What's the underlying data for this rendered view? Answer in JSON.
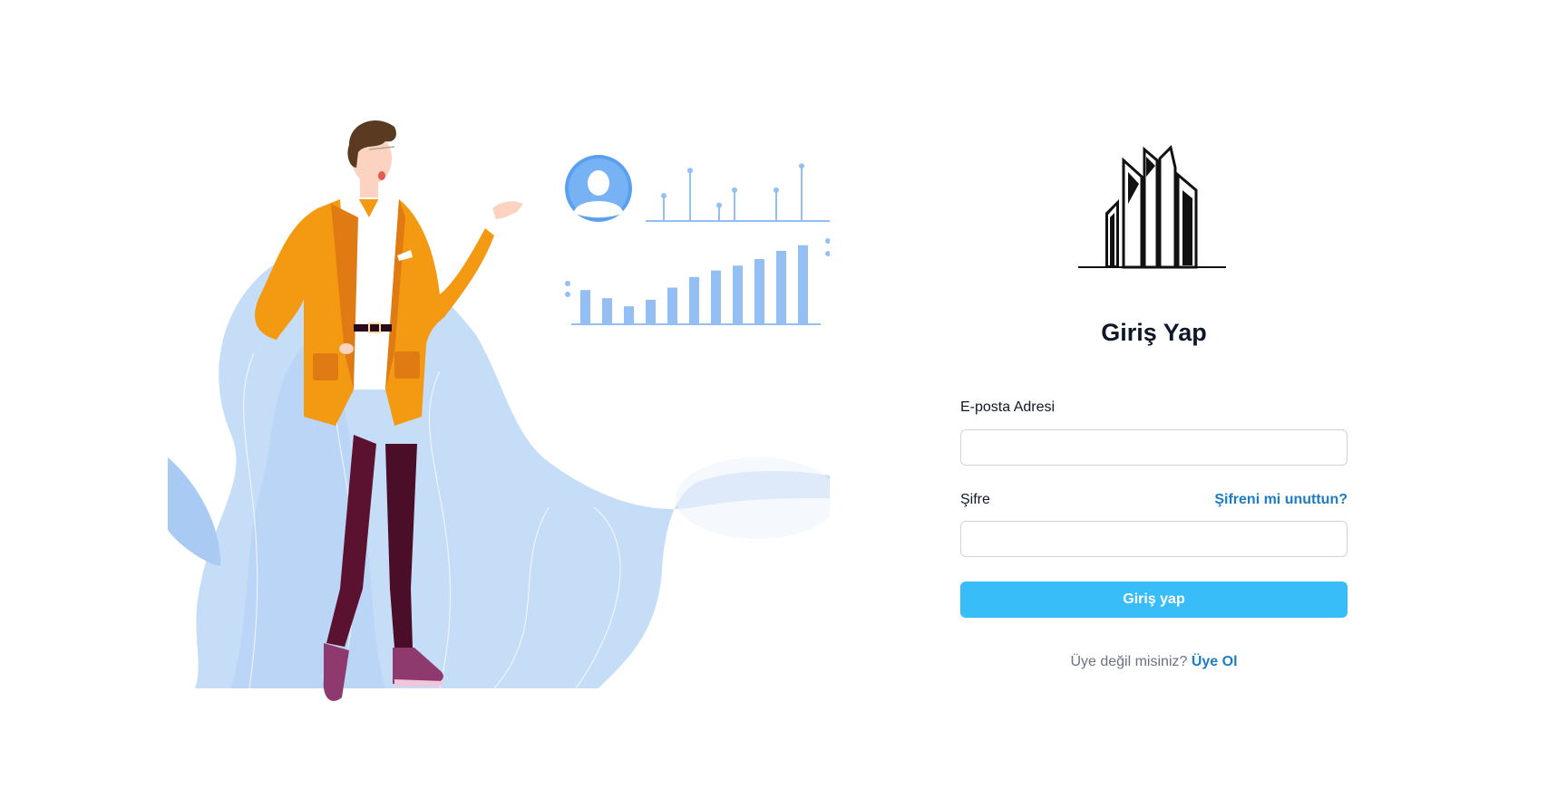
{
  "login": {
    "title": "Giriş Yap",
    "email_label": "E-posta Adresi",
    "email_value": "",
    "password_label": "Şifre",
    "password_value": "",
    "forgot_link": "Şifreni mi unuttun?",
    "submit_label": "Giriş yap",
    "signup_prompt": "Üye değil misiniz?",
    "signup_link": "Üye Ol"
  },
  "colors": {
    "accent": "#38bdf8",
    "link": "#1d7dc2",
    "title": "#0f172a",
    "illustration_blue": "#bcd6f7",
    "chart_bar": "#93bff5",
    "jacket": "#f39a12",
    "pants": "#5a1230"
  },
  "icons": {
    "logo": "city-buildings-logo",
    "avatar": "user-avatar-icon"
  },
  "illustration": {
    "bar_levels": [
      0.42,
      0.32,
      0.22,
      0.3,
      0.45,
      0.58,
      0.66,
      0.72,
      0.8,
      0.9,
      0.97
    ],
    "lollipop_levels": [
      0.45,
      0.9,
      0.28,
      0.55,
      0.55,
      0.98
    ]
  }
}
